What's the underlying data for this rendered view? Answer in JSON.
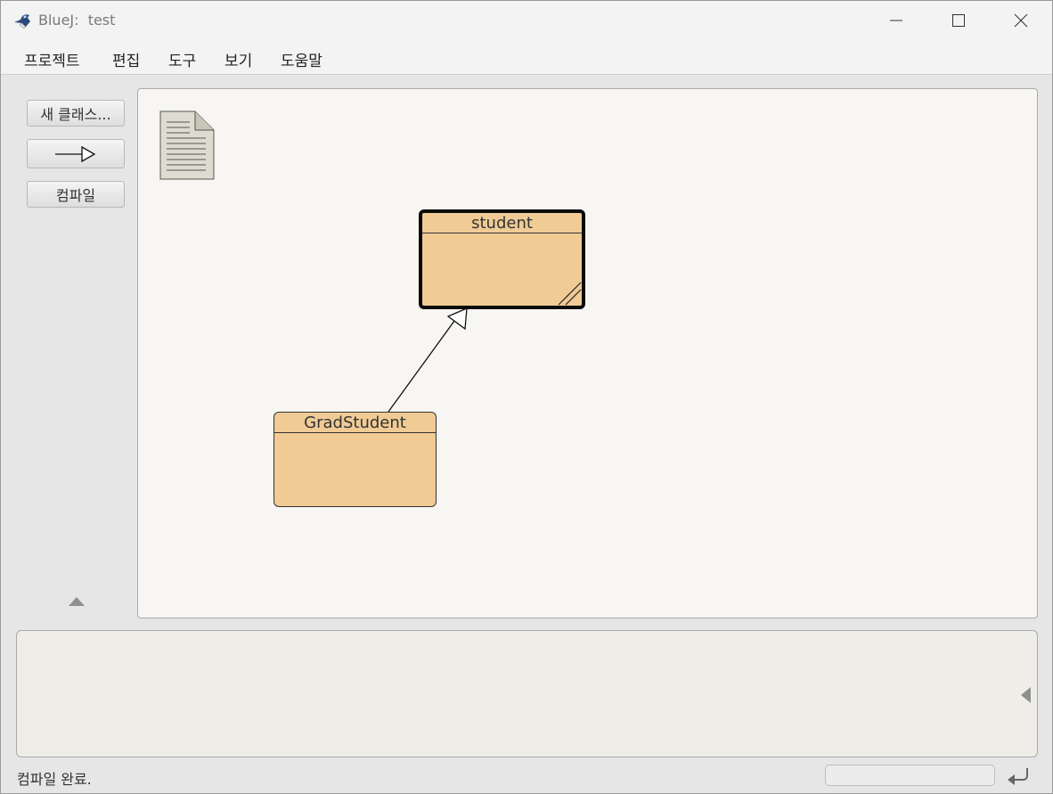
{
  "window": {
    "app_name": "BlueJ:",
    "project_name": "test"
  },
  "menu": [
    {
      "label": "프로젝트"
    },
    {
      "label": "편집"
    },
    {
      "label": "도구"
    },
    {
      "label": "보기"
    },
    {
      "label": "도움말"
    }
  ],
  "toolbar": {
    "new_class_label": "새 클래스...",
    "compile_label": "컴파일"
  },
  "diagram": {
    "classes": [
      {
        "name": "student",
        "selected": true
      },
      {
        "name": "GradStudent",
        "selected": false
      }
    ],
    "relations": [
      {
        "type": "inheritance",
        "from": "GradStudent",
        "to": "student"
      }
    ]
  },
  "status": {
    "message": "컴파일 완료."
  },
  "colors": {
    "class_fill": "#f0cb95",
    "canvas_bg": "#f7f6f2",
    "terminal_bg": "#eeede8"
  }
}
